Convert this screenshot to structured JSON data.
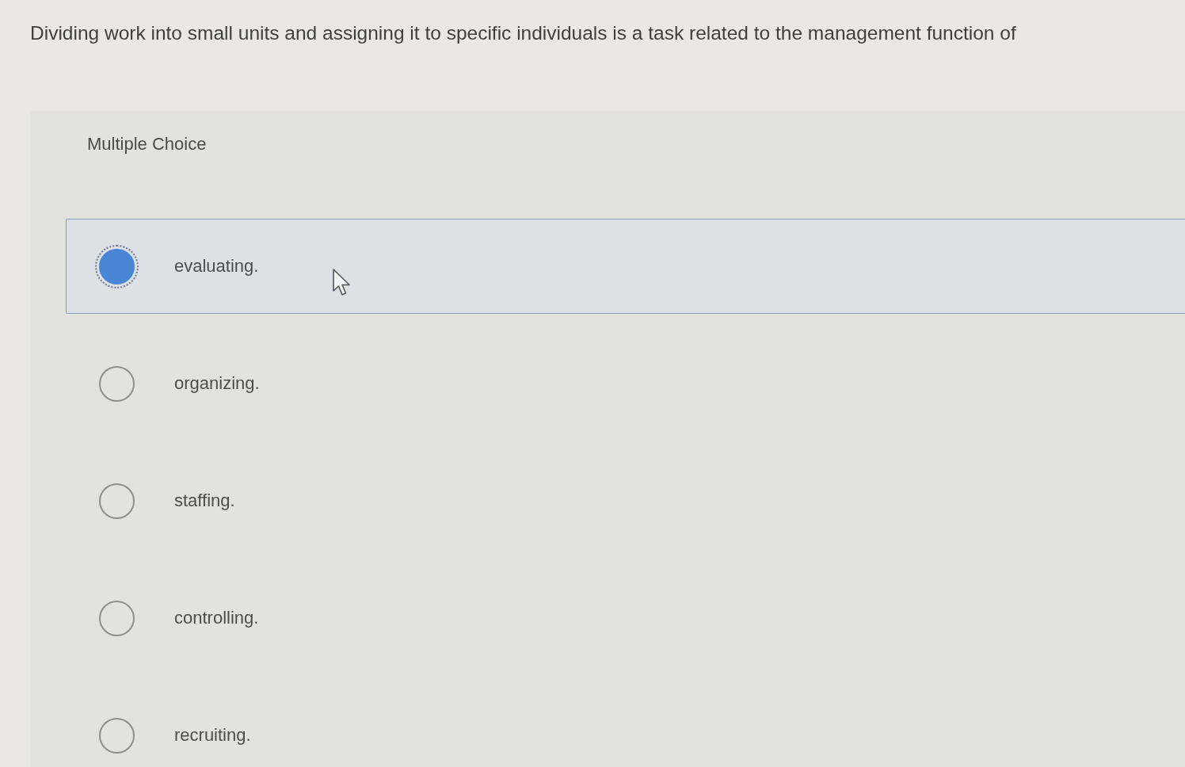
{
  "question": {
    "text": "Dividing work into small units and assigning it to specific individuals is a task related to the management function of"
  },
  "section_label": "Multiple Choice",
  "options": [
    {
      "label": "evaluating.",
      "selected": true
    },
    {
      "label": "organizing.",
      "selected": false
    },
    {
      "label": "staffing.",
      "selected": false
    },
    {
      "label": "controlling.",
      "selected": false
    },
    {
      "label": "recruiting.",
      "selected": false
    }
  ]
}
